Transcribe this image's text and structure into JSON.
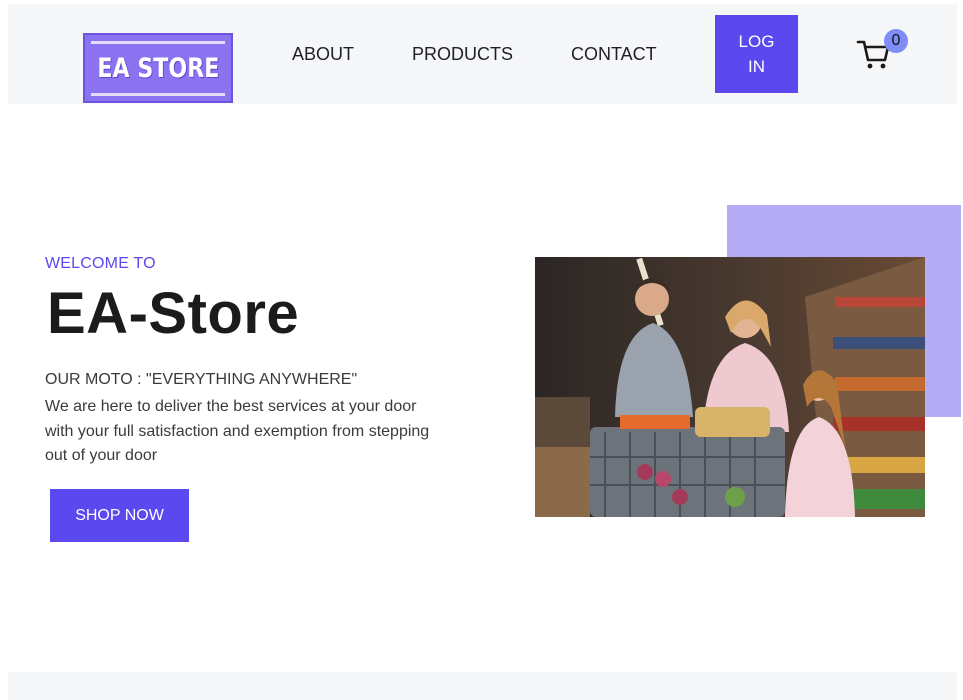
{
  "header": {
    "logo_text": "EA STORE",
    "nav": {
      "about": "ABOUT",
      "products": "PRODUCTS",
      "contact": "CONTACT"
    },
    "login_label": "LOG IN",
    "cart_count": "0",
    "cart_icon": "cart-icon"
  },
  "hero": {
    "eyebrow": "WELCOME TO",
    "title": "EA-Store",
    "moto": "OUR MOTO : \"EVERYTHING ANYWHERE\"",
    "description": "We are here to deliver the best services at your door with your full satisfaction and exemption from stepping out of your door",
    "cta_label": "SHOP NOW",
    "image_subject": "family shopping with cart in supermarket aisle"
  },
  "colors": {
    "brand": "#5b48ee",
    "accent_light": "#b6acf6",
    "badge": "#7f8ef7",
    "header_bg": "#f6f7f9"
  }
}
